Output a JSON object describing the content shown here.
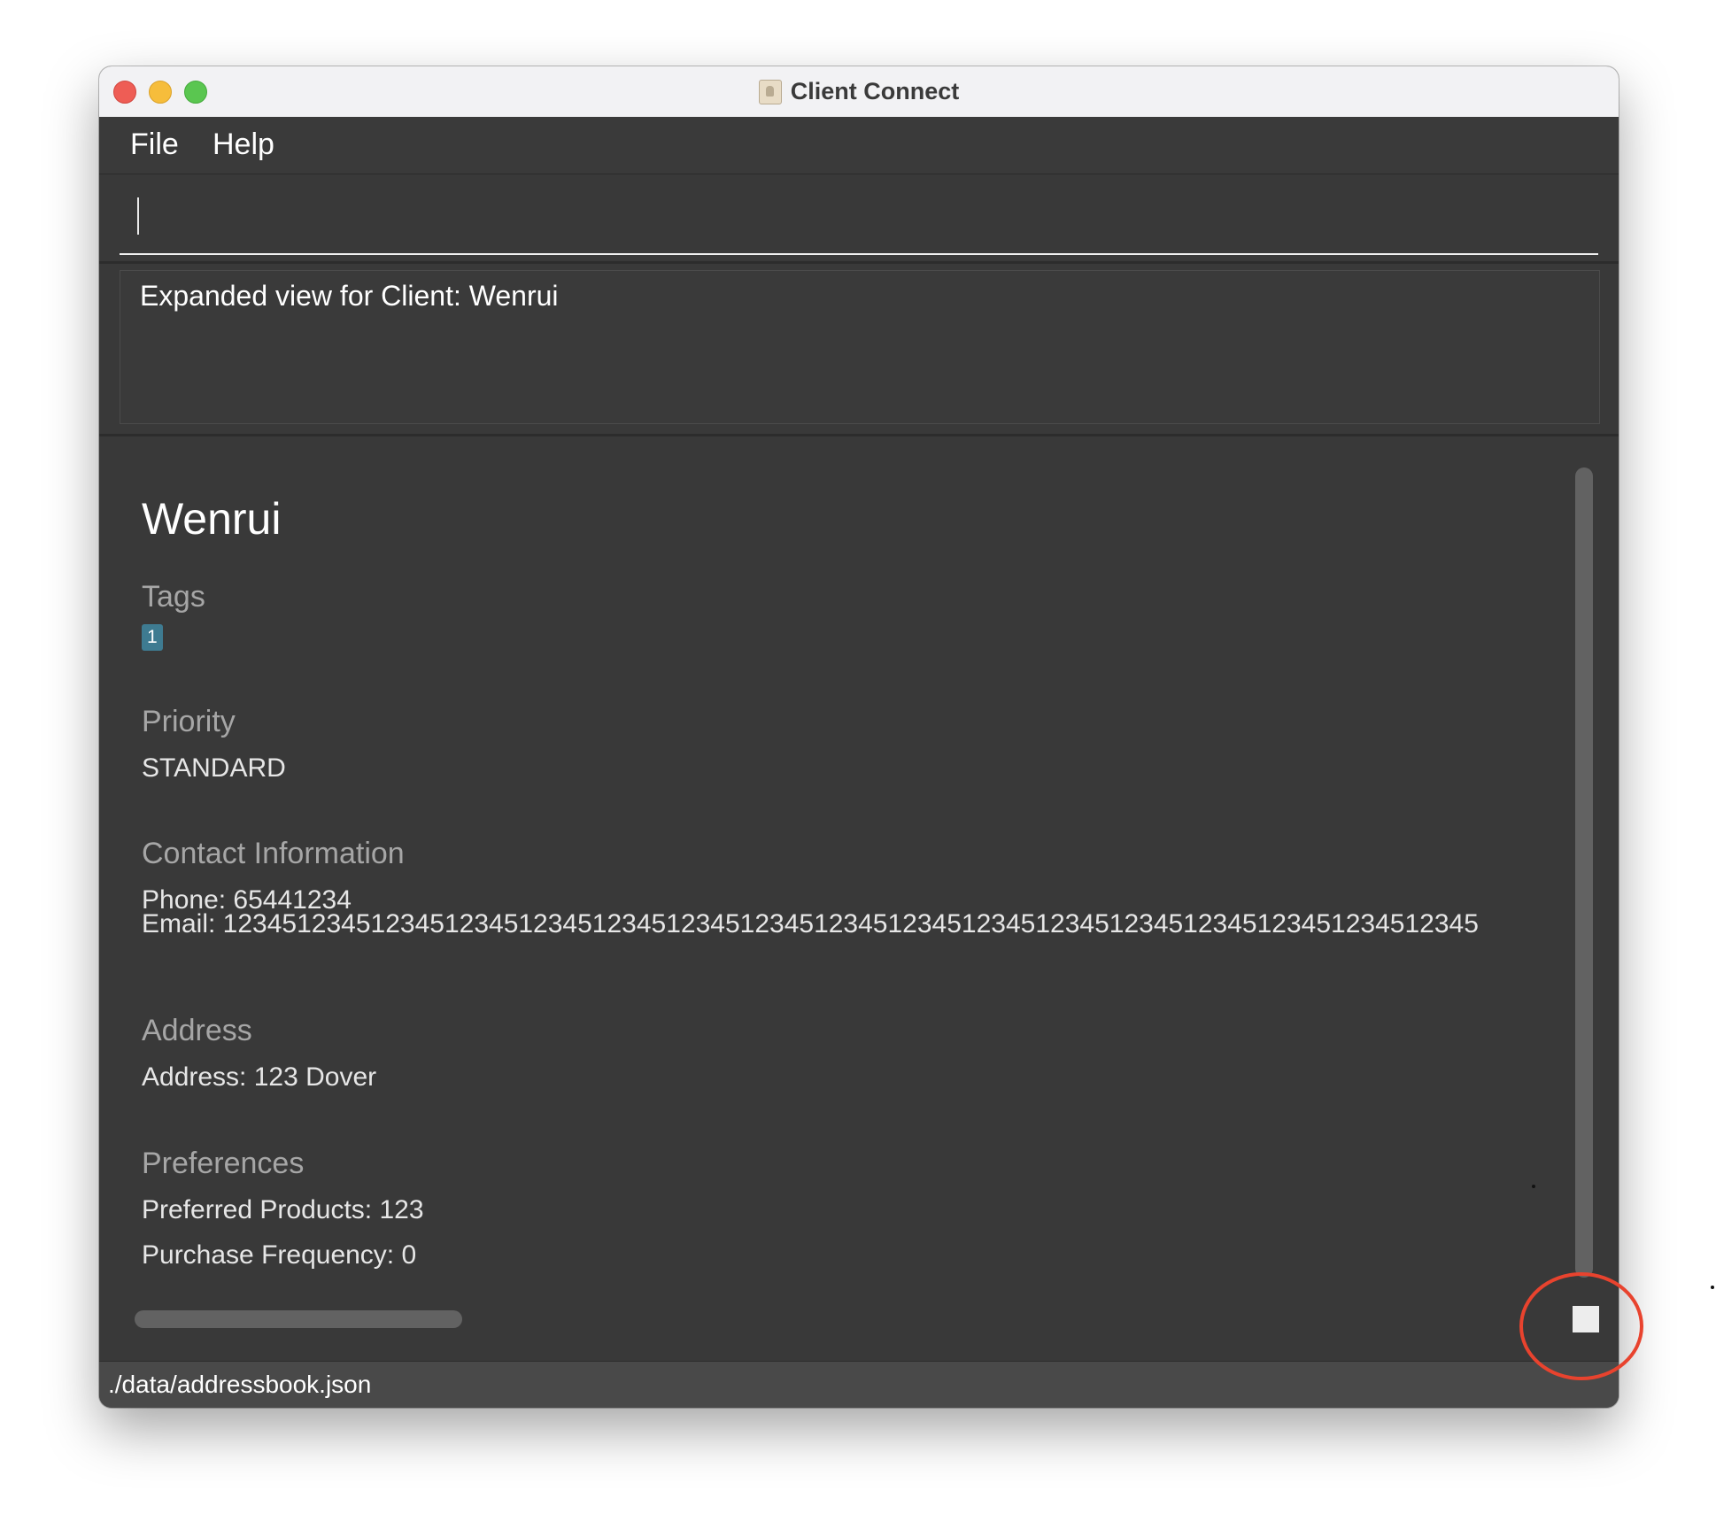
{
  "window": {
    "title": "Client Connect"
  },
  "menu": {
    "items": [
      "File",
      "Help"
    ]
  },
  "command_box": {
    "value": ""
  },
  "result": {
    "message": "Expanded view for Client: Wenrui"
  },
  "client": {
    "name": "Wenrui",
    "sections": {
      "tags_title": "Tags",
      "priority_title": "Priority",
      "contact_title": "Contact Information",
      "address_title": "Address",
      "preferences_title": "Preferences"
    },
    "tags": [
      "1"
    ],
    "priority": "STANDARD",
    "phone": "Phone: 65441234",
    "email": "Email: 1234512345123451234512345123451234512345123451234512345123451234512345123451234512345",
    "address": "Address: 123 Dover",
    "preferred_products": "Preferred Products: 123",
    "purchase_frequency": "Purchase Frequency: 0"
  },
  "status_bar": {
    "path": "./data/addressbook.json"
  },
  "colors": {
    "panel_bg": "#393939",
    "tag_bg": "#3e7b91",
    "annotation": "#e8432e"
  },
  "icons": {
    "close": "close-icon",
    "minimize": "minimize-icon",
    "maximize": "maximize-icon",
    "app": "address-book-icon"
  }
}
